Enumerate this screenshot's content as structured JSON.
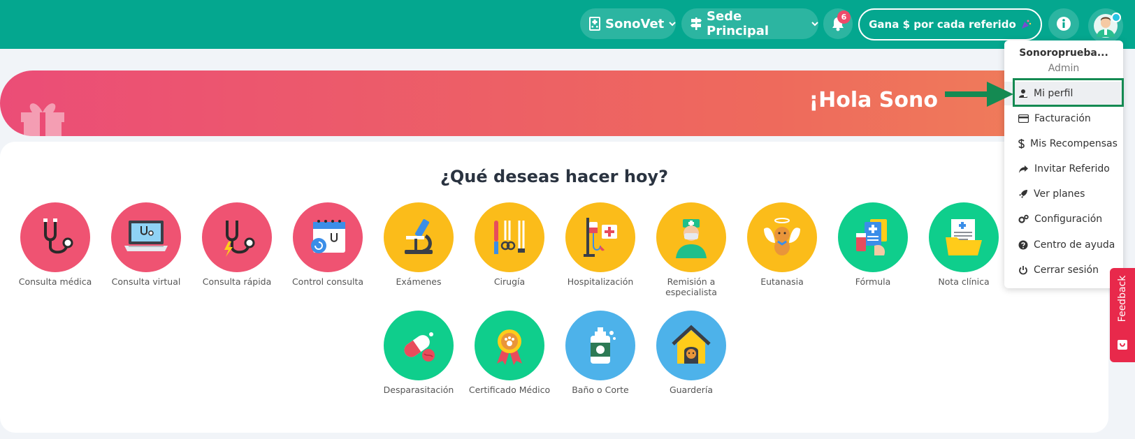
{
  "topbar": {
    "clinic_label": "SonoVet",
    "branch_label": "Sede Principal",
    "notifications_count": "6",
    "referral_label": "Gana $ por cada referido"
  },
  "banner": {
    "greeting": "¡Hola Sono"
  },
  "card": {
    "title": "¿Qué deseas hacer hoy?",
    "actions": [
      {
        "label": "Consulta médica"
      },
      {
        "label": "Consulta virtual"
      },
      {
        "label": "Consulta rápida"
      },
      {
        "label": "Control consulta"
      },
      {
        "label": "Exámenes"
      },
      {
        "label": "Cirugía"
      },
      {
        "label": "Hospitalización"
      },
      {
        "label": "Remisión a especialista"
      },
      {
        "label": "Eutanasia"
      },
      {
        "label": "Fórmula"
      },
      {
        "label": "Nota clínica"
      },
      {
        "label": "Desparasitación"
      },
      {
        "label": "Certificado Médico"
      },
      {
        "label": "Baño o Corte"
      },
      {
        "label": "Guardería"
      }
    ]
  },
  "user_menu": {
    "username": "Sonoroprueba...",
    "role": "Admin",
    "items": [
      {
        "label": "Mi perfil",
        "icon": "user-badge-icon"
      },
      {
        "label": "Facturación",
        "icon": "credit-card-icon"
      },
      {
        "label": "Mis Recompensas",
        "icon": "dollar-icon"
      },
      {
        "label": "Invitar Referido",
        "icon": "share-arrow-icon"
      },
      {
        "label": "Ver planes",
        "icon": "rocket-icon"
      },
      {
        "label": "Configuración",
        "icon": "gears-icon"
      },
      {
        "label": "Centro de ayuda",
        "icon": "question-circle-icon"
      },
      {
        "label": "Cerrar sesión",
        "icon": "power-icon"
      }
    ]
  },
  "feedback": {
    "label": "Feedback"
  },
  "colors": {
    "topbar": "#04a78f",
    "red": "#ef5372",
    "yellow": "#fbbc1a",
    "green": "#0fce8c",
    "blue": "#4db2ea",
    "highlight": "#148a52",
    "feedback": "#e8294b"
  }
}
